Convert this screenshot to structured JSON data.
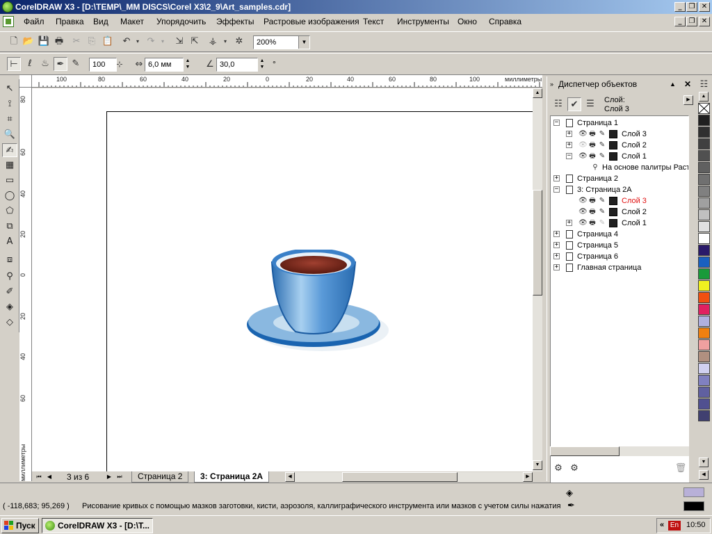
{
  "window": {
    "title": "CorelDRAW X3 - [D:\\TEMP\\_MM DISCS\\Corel X3\\2_9\\Art_samples.cdr]",
    "minimize_icon": "minimize-icon",
    "restore_icon": "restore-icon",
    "close_icon": "close-icon"
  },
  "menu": {
    "items": [
      "Файл",
      "Правка",
      "Вид",
      "Макет",
      "Упорядочить",
      "Эффекты",
      "Растровые изображения",
      "Текст",
      "Инструменты",
      "Окно",
      "Справка"
    ]
  },
  "standard_toolbar": {
    "zoom_value": "200%"
  },
  "property_bar": {
    "size_value": "100",
    "width_value": "6,0 мм",
    "angle_value": "30,0",
    "degree_symbol": "°"
  },
  "rulers": {
    "top_labels": [
      "100",
      "80",
      "60",
      "40",
      "20",
      "0",
      "20",
      "40",
      "60",
      "80",
      "100"
    ],
    "top_unit": "миллиметры",
    "left_labels": [
      "80",
      "60",
      "40",
      "20",
      "0",
      "20",
      "40",
      "60"
    ],
    "left_unit": "миллиметры"
  },
  "page_nav": {
    "counter": "3 из 6",
    "tabs": [
      "Страница 2",
      "3: Страница 2A"
    ],
    "active_tab": 1
  },
  "object_manager": {
    "title": "Диспетчер объектов",
    "layer_label": "Слой:",
    "layer_value": "Слой 3",
    "tree": [
      {
        "label": "Страница 1",
        "level": 0,
        "expanded": true
      },
      {
        "label": "Слой 3",
        "level": 1,
        "expanded": false
      },
      {
        "label": "Слой 2",
        "level": 1,
        "expanded": false
      },
      {
        "label": "Слой 1",
        "level": 1,
        "expanded": true
      },
      {
        "label": "На основе палитры Растр",
        "level": 2
      },
      {
        "label": "Страница 2",
        "level": 0,
        "expanded": false
      },
      {
        "label": "3: Страница 2A",
        "level": 0,
        "expanded": true
      },
      {
        "label": "Слой 3",
        "level": 1,
        "active": true
      },
      {
        "label": "Слой 2",
        "level": 1
      },
      {
        "label": "Слой 1",
        "level": 1,
        "expanded": false
      },
      {
        "label": "Страница 4",
        "level": 0,
        "expanded": false
      },
      {
        "label": "Страница 5",
        "level": 0,
        "expanded": false
      },
      {
        "label": "Страница 6",
        "level": 0,
        "expanded": false
      },
      {
        "label": "Главная страница",
        "level": 0,
        "expanded": false
      }
    ]
  },
  "palette": {
    "colors": [
      "#202020",
      "#303030",
      "#404040",
      "#505050",
      "#606060",
      "#707070",
      "#808080",
      "#a0a0a0",
      "#c0c0c0",
      "#e0e0e0",
      "#ffffff",
      "#2a1a6a",
      "#1a60c0",
      "#1a9a3a",
      "#f0f020",
      "#f05010",
      "#e02060",
      "#b0b0e0",
      "#f08010",
      "#f0a0a0",
      "#b09080",
      "#d0d0f0",
      "#8080c0",
      "#6060a0",
      "#505090",
      "#404070"
    ]
  },
  "status": {
    "coordinates": "( -118,683; 95,269 )",
    "message": "Рисование кривых с помощью мазков заготовки, кисти, аэрозоля, каллиграфического инструмента или мазков с учетом силы нажатия",
    "fill_color": "#b8b0d8",
    "outline_color": "#000000"
  },
  "taskbar": {
    "start_label": "Пуск",
    "task_label": "CorelDRAW X3 - [D:\\T...",
    "lang": "En",
    "clock": "10:50"
  },
  "accent": {
    "title_blue": "#0a246a",
    "active_layer_red": "#e01010",
    "cup_blue": "#2a78c0"
  }
}
